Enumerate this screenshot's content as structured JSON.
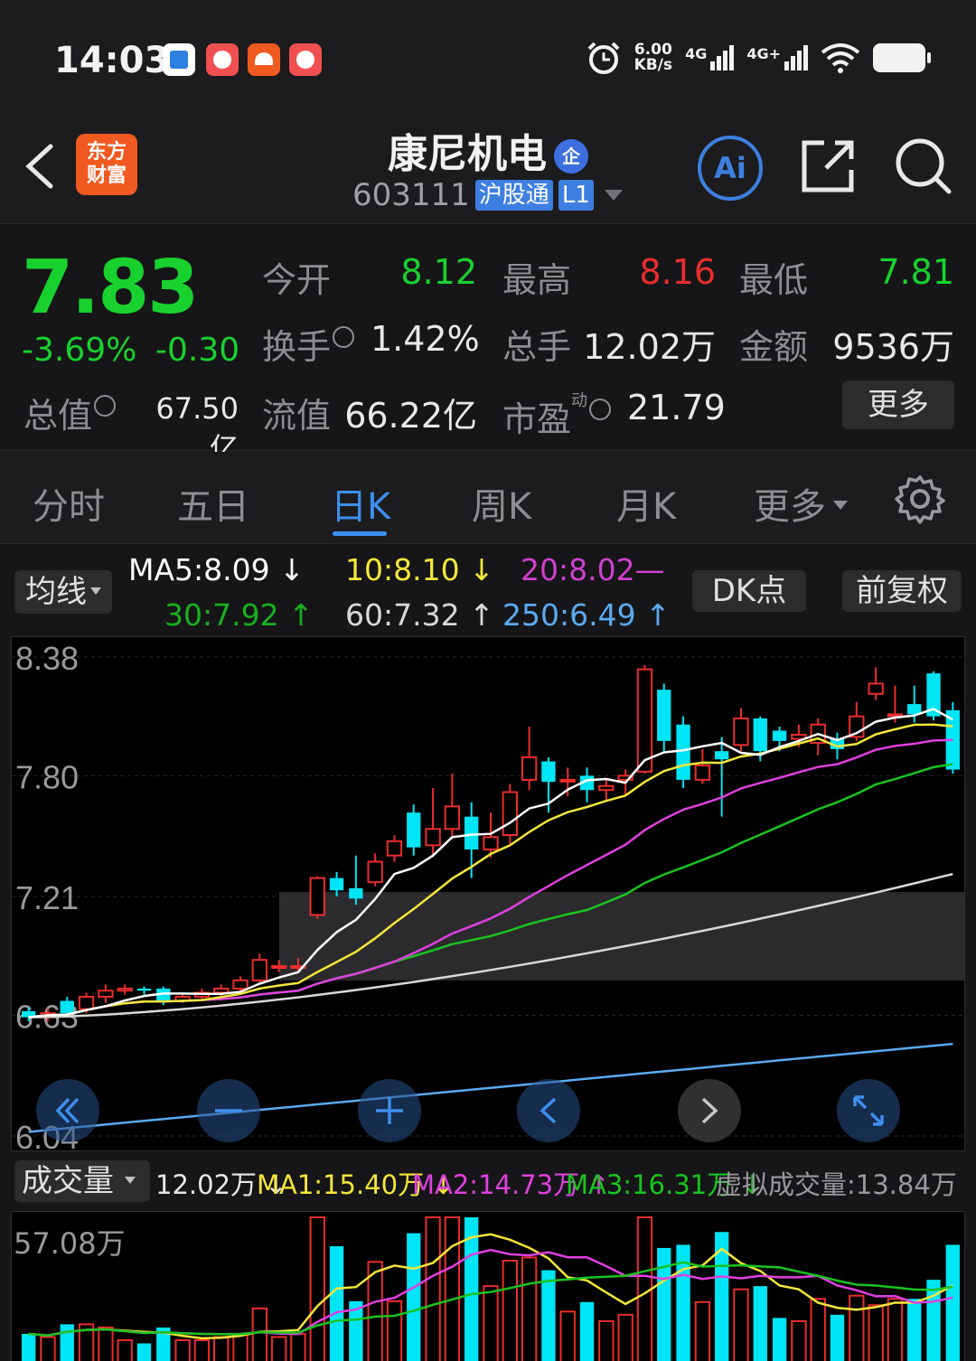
{
  "status_bar": {
    "time": "14:03",
    "speed_value": "6.00",
    "speed_unit": "KB/s",
    "net1": "4G",
    "net2": "4G+"
  },
  "header": {
    "logo_line1": "东方",
    "logo_line2": "财富",
    "stock_name": "康尼机电",
    "qi_badge": "企",
    "stock_code": "603111",
    "tag_market": "沪股通",
    "tag_level": "L1",
    "ai_label": "Ai"
  },
  "quote": {
    "price": "7.83",
    "change_pct": "-3.69%",
    "change_abs": "-0.30",
    "open_label": "今开",
    "open_value": "8.12",
    "high_label": "最高",
    "high_value": "8.16",
    "low_label": "最低",
    "low_value": "7.81",
    "turnover_label": "换手",
    "turnover_value": "1.42%",
    "volume_label": "总手",
    "volume_value": "12.02万",
    "amount_label": "金额",
    "amount_value": "9536万",
    "mktcap_label": "总值",
    "mktcap_value": "67.50亿",
    "float_label": "流值",
    "float_value": "66.22亿",
    "pe_label": "市盈",
    "pe_sup": "动",
    "pe_value": "21.79",
    "more_label": "更多"
  },
  "tabs": [
    {
      "label": "分时"
    },
    {
      "label": "五日"
    },
    {
      "label": "日K"
    },
    {
      "label": "周K"
    },
    {
      "label": "月K"
    },
    {
      "label": "更多"
    }
  ],
  "ma_row": {
    "ma_select": "均线",
    "ma5": "MA5:8.09 ↓",
    "ma10": "10:8.10 ↓",
    "ma20": "20:8.02—",
    "ma30": "30:7.92 ↑",
    "ma60": "60:7.32 ↑",
    "ma250": "250:6.49 ↑",
    "dk_label": "DK点",
    "adjust_label": "前复权",
    "colors": {
      "ma5": "#ffffff",
      "ma10": "#f5e63a",
      "ma20": "#e040e0",
      "ma30": "#19c41f",
      "ma60": "#d8d8d8",
      "ma250": "#5aaaf0"
    }
  },
  "chart_data": {
    "type": "candlestick",
    "y_tick_labels": [
      "8.38",
      "7.80",
      "7.21",
      "6.63",
      "6.04"
    ],
    "ylim": [
      6.04,
      8.38
    ],
    "up_color": "#ea2d2d",
    "down_color": "#00e5f5",
    "candles": [
      [
        6.65,
        6.62,
        6.67,
        6.6
      ],
      [
        6.62,
        6.64,
        6.66,
        6.6
      ],
      [
        6.7,
        6.64,
        6.72,
        6.62
      ],
      [
        6.66,
        6.72,
        6.74,
        6.64
      ],
      [
        6.72,
        6.75,
        6.78,
        6.69
      ],
      [
        6.75,
        6.76,
        6.78,
        6.73
      ],
      [
        6.76,
        6.75,
        6.77,
        6.73
      ],
      [
        6.76,
        6.7,
        6.77,
        6.68
      ],
      [
        6.7,
        6.72,
        6.74,
        6.69
      ],
      [
        6.72,
        6.74,
        6.76,
        6.71
      ],
      [
        6.74,
        6.76,
        6.78,
        6.72
      ],
      [
        6.76,
        6.8,
        6.82,
        6.75
      ],
      [
        6.8,
        6.9,
        6.93,
        6.78
      ],
      [
        6.87,
        6.87,
        6.9,
        6.84
      ],
      [
        6.87,
        6.87,
        6.91,
        6.84
      ],
      [
        7.12,
        7.3,
        7.31,
        7.1
      ],
      [
        7.3,
        7.24,
        7.33,
        7.21
      ],
      [
        7.25,
        7.2,
        7.41,
        7.17
      ],
      [
        7.28,
        7.38,
        7.42,
        7.26
      ],
      [
        7.41,
        7.48,
        7.51,
        7.38
      ],
      [
        7.62,
        7.45,
        7.66,
        7.41
      ],
      [
        7.46,
        7.54,
        7.74,
        7.41
      ],
      [
        7.54,
        7.65,
        7.81,
        7.49
      ],
      [
        7.6,
        7.44,
        7.67,
        7.3
      ],
      [
        7.44,
        7.5,
        7.62,
        7.4
      ],
      [
        7.51,
        7.72,
        7.76,
        7.46
      ],
      [
        7.78,
        7.89,
        8.04,
        7.73
      ],
      [
        7.87,
        7.77,
        7.89,
        7.62
      ],
      [
        7.78,
        7.78,
        7.84,
        7.7
      ],
      [
        7.8,
        7.73,
        7.84,
        7.67
      ],
      [
        7.73,
        7.75,
        7.79,
        7.68
      ],
      [
        7.78,
        7.8,
        7.83,
        7.7
      ],
      [
        7.82,
        8.32,
        8.34,
        7.81
      ],
      [
        8.22,
        7.97,
        8.25,
        7.91
      ],
      [
        8.05,
        7.78,
        8.09,
        7.74
      ],
      [
        7.78,
        7.85,
        7.93,
        7.76
      ],
      [
        7.92,
        7.88,
        7.99,
        7.6
      ],
      [
        7.95,
        8.08,
        8.13,
        7.92
      ],
      [
        8.08,
        7.92,
        8.09,
        7.87
      ],
      [
        8.02,
        7.97,
        8.04,
        7.92
      ],
      [
        7.98,
        8.0,
        8.05,
        7.94
      ],
      [
        7.96,
        8.05,
        8.08,
        7.9
      ],
      [
        7.98,
        7.93,
        8.01,
        7.88
      ],
      [
        7.99,
        8.09,
        8.16,
        7.97
      ],
      [
        8.2,
        8.25,
        8.33,
        8.17
      ],
      [
        8.1,
        8.1,
        8.24,
        8.06
      ],
      [
        8.15,
        8.1,
        8.24,
        8.06
      ],
      [
        8.3,
        8.09,
        8.31,
        8.07
      ],
      [
        8.12,
        7.83,
        8.16,
        7.81
      ]
    ]
  },
  "volume": {
    "label": "成交量",
    "current": "12.02万 ↓",
    "ma1": "MA1:15.40万 ↓",
    "ma2": "MA2:14.73万 ↑",
    "ma3": "MA3:16.31万 ↓",
    "virtual": "虚拟成交量:13.84万",
    "max_label": "57.08万",
    "ma_colors": {
      "ma1": "#f5e63a",
      "ma2": "#e040e0",
      "ma3": "#19c41f"
    }
  }
}
